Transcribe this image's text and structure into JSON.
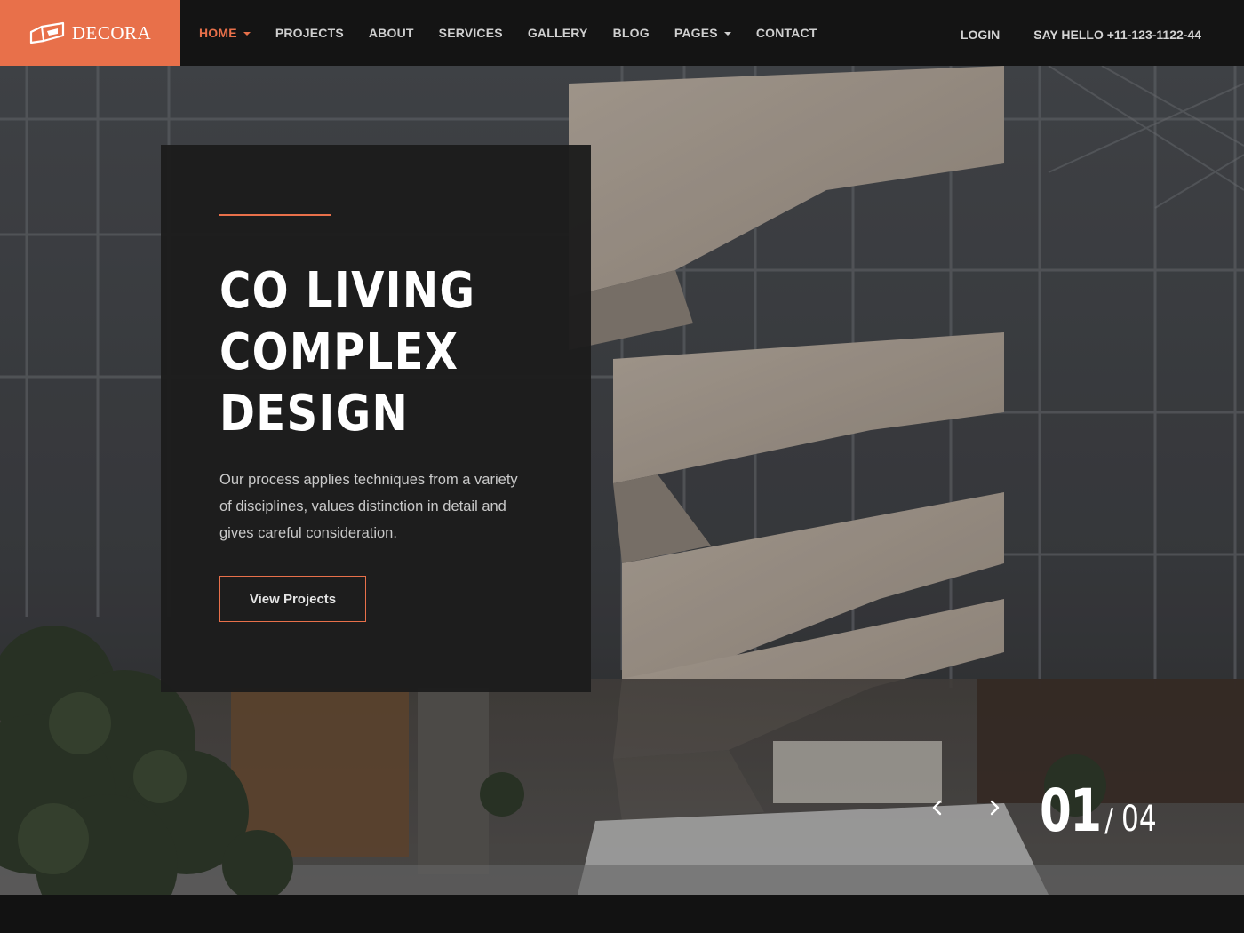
{
  "brand": {
    "name": "DECORA",
    "accent_color": "#e8704a"
  },
  "nav": {
    "items": [
      {
        "label": "HOME",
        "active": true,
        "has_dropdown": true
      },
      {
        "label": "PROJECTS",
        "active": false,
        "has_dropdown": false
      },
      {
        "label": "ABOUT",
        "active": false,
        "has_dropdown": false
      },
      {
        "label": "SERVICES",
        "active": false,
        "has_dropdown": false
      },
      {
        "label": "GALLERY",
        "active": false,
        "has_dropdown": false
      },
      {
        "label": "BLOG",
        "active": false,
        "has_dropdown": false
      },
      {
        "label": "PAGES",
        "active": false,
        "has_dropdown": true
      },
      {
        "label": "CONTACT",
        "active": false,
        "has_dropdown": false
      }
    ]
  },
  "header_right": {
    "login_label": "LOGIN",
    "hello_label": "SAY HELLO +11-123-1122-44"
  },
  "hero": {
    "title_lines": [
      "CO LIVING",
      "COMPLEX",
      "DESIGN"
    ],
    "description": "Our process applies techniques from a variety of disciplines, values distinction in detail and gives careful consideration.",
    "button_label": "View Projects",
    "prev_icon": "chevron-left-icon",
    "next_icon": "chevron-right-icon",
    "slide_current": "01",
    "slide_separator": "/",
    "slide_total": "04"
  }
}
